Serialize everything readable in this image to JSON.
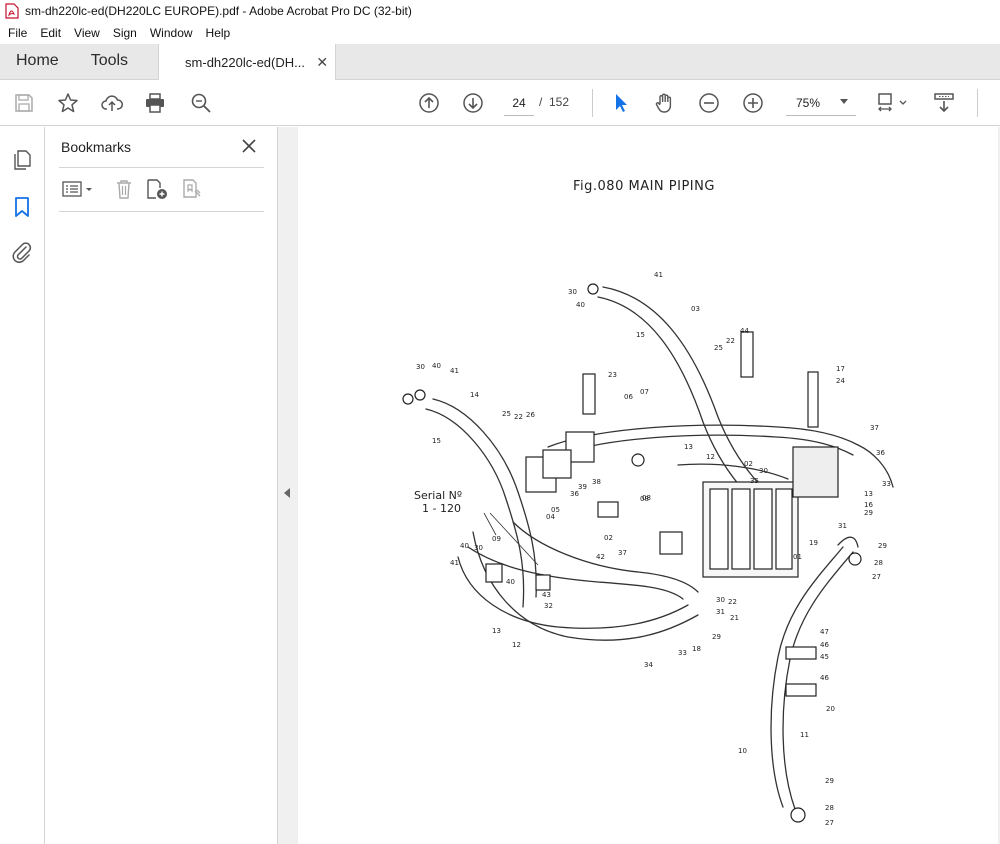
{
  "window": {
    "title": "sm-dh220lc-ed(DH220LC EUROPE).pdf - Adobe Acrobat Pro DC (32-bit)"
  },
  "menu": [
    "File",
    "Edit",
    "View",
    "Sign",
    "Window",
    "Help"
  ],
  "tabs": {
    "home": "Home",
    "tools": "Tools",
    "document": "sm-dh220lc-ed(DH..."
  },
  "toolbar": {
    "page_current": "24",
    "page_separator": "/",
    "page_total": "152",
    "zoom": "75%"
  },
  "bookmarks": {
    "title": "Bookmarks"
  },
  "document": {
    "figure_title": "Fig.080 MAIN PIPING",
    "serial_label": "Serial Nº",
    "serial_range": "1 - 120",
    "part_labels": [
      "41",
      "30",
      "40",
      "03",
      "15",
      "44",
      "25",
      "22",
      "17",
      "24",
      "23",
      "30",
      "40",
      "41",
      "14",
      "15",
      "25",
      "22",
      "26",
      "06",
      "07",
      "37",
      "13",
      "12",
      "36",
      "02",
      "30",
      "33",
      "13",
      "16",
      "29",
      "31",
      "19",
      "01",
      "05",
      "04",
      "38",
      "39",
      "36",
      "08",
      "09",
      "40",
      "30",
      "41",
      "40",
      "43",
      "32",
      "13",
      "12",
      "34",
      "33",
      "18",
      "29",
      "21",
      "22",
      "30",
      "31",
      "29",
      "28",
      "27",
      "47",
      "46",
      "45",
      "46",
      "20",
      "10",
      "11",
      "29",
      "28",
      "27",
      "35",
      "08",
      "02",
      "37",
      "42"
    ]
  },
  "colors": {
    "accent_blue": "#1473e6",
    "icon_gray": "#555555",
    "rail_border": "#d4d4d4"
  }
}
